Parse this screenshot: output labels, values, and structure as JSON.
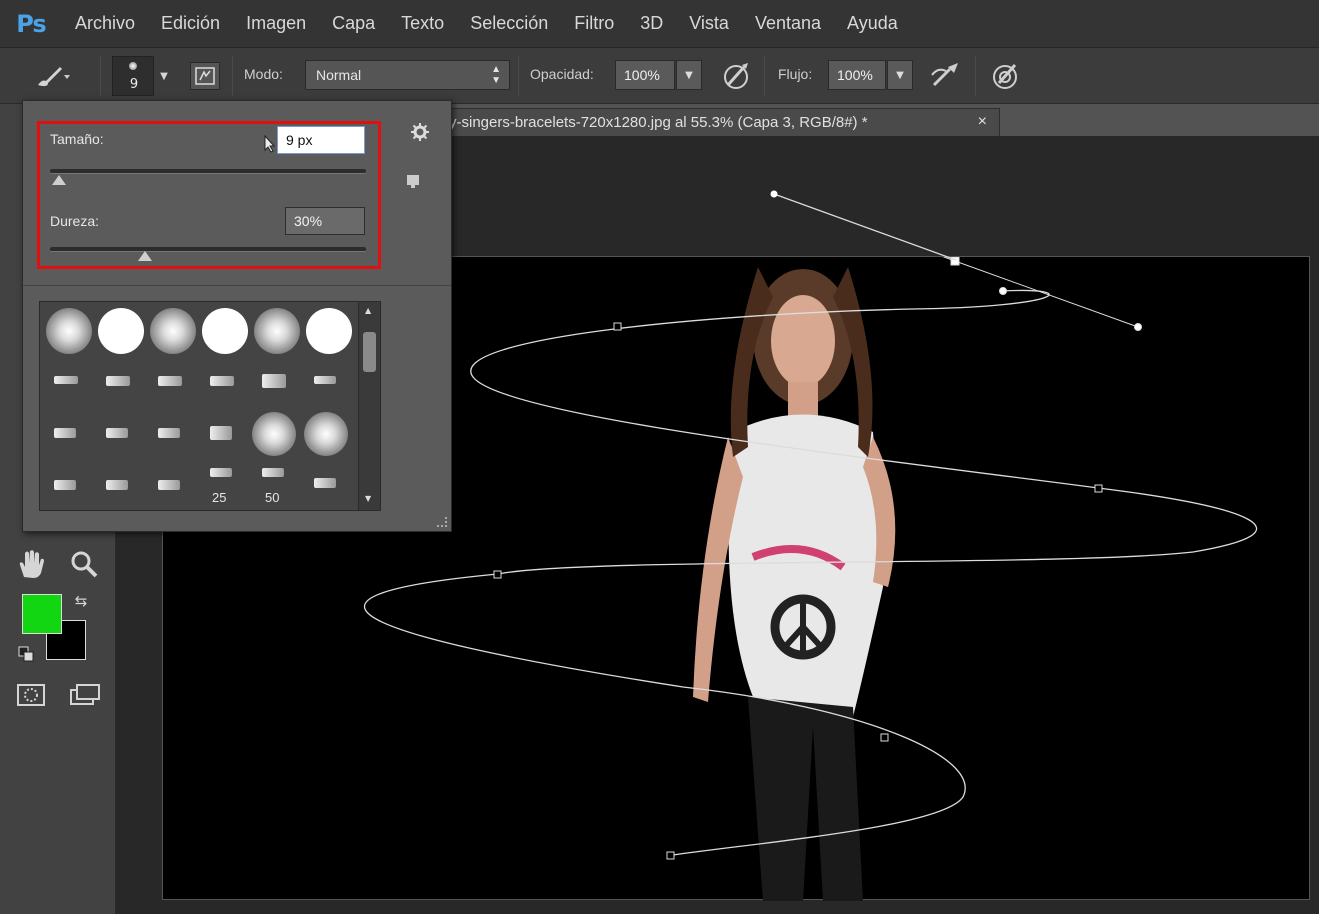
{
  "app": {
    "logo": "Ps"
  },
  "menu": [
    "Archivo",
    "Edición",
    "Imagen",
    "Capa",
    "Texto",
    "Selección",
    "Filtro",
    "3D",
    "Vista",
    "Ventana",
    "Ayuda"
  ],
  "options": {
    "brush_size_preview": "9",
    "mode_label": "Modo:",
    "mode_value": "Normal",
    "opacity_label": "Opacidad:",
    "opacity_value": "100%",
    "flow_label": "Flujo:",
    "flow_value": "100%"
  },
  "document": {
    "tab_title": "y-singers-bracelets-720x1280.jpg al 55.3% (Capa 3, RGB/8#) *",
    "close": "×"
  },
  "brush_panel": {
    "size_label": "Tamaño:",
    "size_value": "9 px",
    "size_fraction": 0.01,
    "hardness_label": "Dureza:",
    "hardness_value": "30%",
    "hardness_fraction": 0.3,
    "preset_sizes": [
      "25",
      "50"
    ]
  },
  "colors": {
    "foreground": "#11d611",
    "background": "#000000",
    "accent_frame": "#e01010"
  },
  "icons": [
    "brush-icon",
    "hand-icon",
    "zoom-icon",
    "swap-colors-icon",
    "default-colors-icon",
    "quick-mask-icon",
    "screen-mode-icon",
    "gear-icon",
    "pressure-opacity-icon",
    "airbrush-icon",
    "pressure-size-icon",
    "brush-panel-toggle-icon"
  ]
}
